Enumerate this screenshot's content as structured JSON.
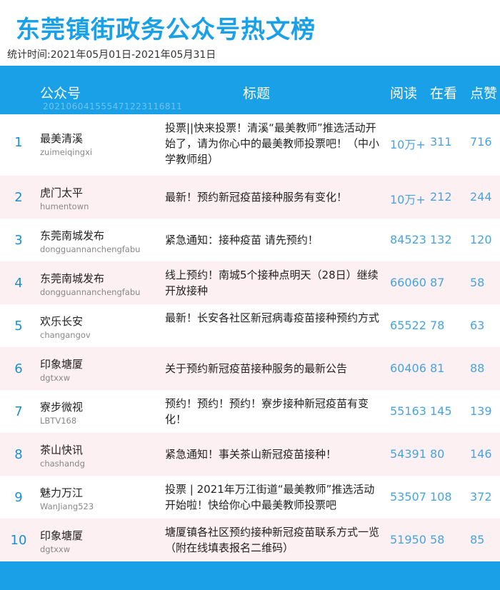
{
  "title": "东莞镇街政务公众号热文榜",
  "period": "统计时间:2021年05月01日-2021年05月31日",
  "header": {
    "account": "公众号",
    "title": "标题",
    "read": "阅读",
    "watch": "在看",
    "like": "点赞",
    "watermark": "20210604155547122311681​1"
  },
  "colors": {
    "accent": "#1aa0e6",
    "stripe": "#fdf0f2",
    "number": "#4aa3df"
  },
  "rows": [
    {
      "rank": "1",
      "name": "最美清溪",
      "id": "zuimeiqingxi",
      "title": "投票||快来投票！清溪“最美教师”推选活动开始了，请为你心中的最美教师投票吧！（中小学教师组）",
      "read": "10万+",
      "watch": "311",
      "like": "716"
    },
    {
      "rank": "2",
      "name": "虎门太平",
      "id": "humentown",
      "title": "最新！预约新冠疫苗接种服务有变化！",
      "read": "10万+",
      "watch": "212",
      "like": "244"
    },
    {
      "rank": "3",
      "name": "东莞南城发布",
      "id": "dongguannanchengfabu",
      "title": "紧急通知：接种疫苗  请先预约！",
      "read": "84523",
      "watch": "132",
      "like": "120"
    },
    {
      "rank": "4",
      "name": "东莞南城发布",
      "id": "dongguannanchengfabu",
      "title": "线上预约！南城5个接种点明天（28日）继续开放接种",
      "read": "66060",
      "watch": "87",
      "like": "58"
    },
    {
      "rank": "5",
      "name": "欢乐长安",
      "id": "changangov",
      "title": "最新！长安各社区新冠病毒疫苗接种预约方式",
      "read": "65522",
      "watch": "78",
      "like": "63"
    },
    {
      "rank": "6",
      "name": "印象塘厦",
      "id": "dgtxxw",
      "title": "关于预约新冠疫苗接种服务的最新公告",
      "read": "60406",
      "watch": "81",
      "like": "88"
    },
    {
      "rank": "7",
      "name": "寮步微视",
      "id": "LBTV168",
      "title": "预约！预约！预约！寮步接种新冠疫苗有变化！",
      "read": "55163",
      "watch": "145",
      "like": "139"
    },
    {
      "rank": "8",
      "name": "茶山快讯",
      "id": "chashandg",
      "title": "紧急通知！事关茶山新冠疫苗接种！",
      "read": "54391",
      "watch": "80",
      "like": "146"
    },
    {
      "rank": "9",
      "name": "魅力万江",
      "id": "WanJiang523",
      "title": "投票 | 2021年万江街道“最美教师”推选活动开始啦！快给你心中最美教师投票吧",
      "read": "53507",
      "watch": "108",
      "like": "372"
    },
    {
      "rank": "10",
      "name": "印象塘厦",
      "id": "dgtxxw",
      "title": "塘厦镇各社区预约接种新冠疫苗联系方式一览（附在线填表报名二维码）",
      "read": "51950",
      "watch": "58",
      "like": "85"
    }
  ]
}
